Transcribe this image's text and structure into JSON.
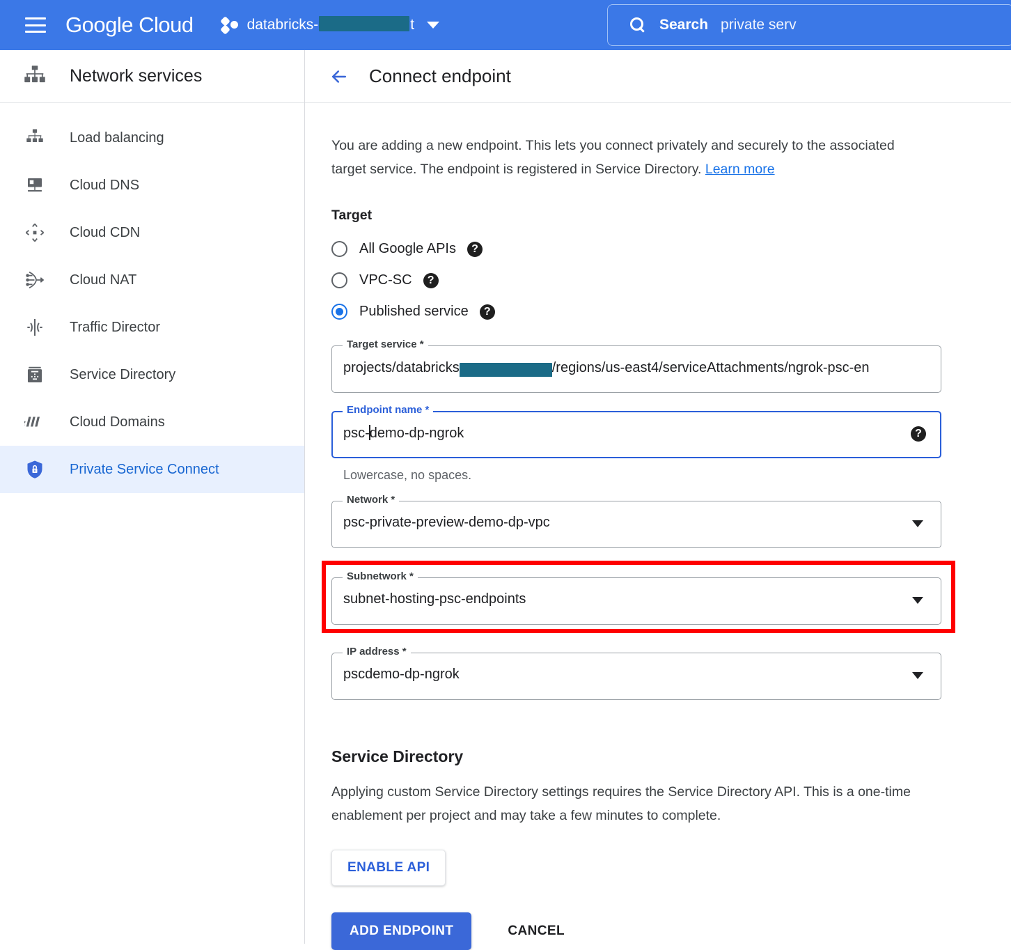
{
  "topbar": {
    "menu_icon": "hamburger-menu-icon",
    "logo_google": "Google",
    "logo_cloud": " Cloud",
    "project_icon": "project-hexagons-icon",
    "project_prefix": "databricks-",
    "project_suffix": "t",
    "project_redacted": true,
    "caret_icon": "chevron-down-icon",
    "search": {
      "icon": "search-icon",
      "label": "Search",
      "value": "private serv"
    },
    "bg_color": "#3b78e7"
  },
  "sidebar": {
    "header_icon": "network-services-icon",
    "header_title": "Network services",
    "items": [
      {
        "label": "Load balancing",
        "icon": "load-balancing-icon",
        "active": false
      },
      {
        "label": "Cloud DNS",
        "icon": "cloud-dns-icon",
        "active": false
      },
      {
        "label": "Cloud CDN",
        "icon": "cloud-cdn-icon",
        "active": false
      },
      {
        "label": "Cloud NAT",
        "icon": "cloud-nat-icon",
        "active": false
      },
      {
        "label": "Traffic Director",
        "icon": "traffic-director-icon",
        "active": false
      },
      {
        "label": "Service Directory",
        "icon": "service-directory-icon",
        "active": false
      },
      {
        "label": "Cloud Domains",
        "icon": "cloud-domains-icon",
        "active": false
      },
      {
        "label": "Private Service Connect",
        "icon": "shield-lock-icon",
        "active": true
      }
    ],
    "active_color": "#1967d2",
    "active_bg": "#e8f0fe"
  },
  "main": {
    "back_icon": "back-arrow-icon",
    "title": "Connect endpoint",
    "intro_text": "You are adding a new endpoint. This lets you connect privately and securely to the associated target service. The endpoint is registered in Service Directory. ",
    "intro_link": "Learn more",
    "target_section_label": "Target",
    "radios": [
      {
        "label": "All Google APIs",
        "selected": false,
        "help": "?"
      },
      {
        "label": "VPC-SC",
        "selected": false,
        "help": "?"
      },
      {
        "label": "Published service",
        "selected": true,
        "help": "?"
      }
    ],
    "fields": {
      "target_service": {
        "label": "Target service *",
        "value_prefix": "projects/databricks",
        "value_suffix": "/regions/us-east4/serviceAttachments/ngrok-psc-en",
        "redacted": true,
        "focused": false
      },
      "endpoint_name": {
        "label": "Endpoint name  *",
        "value_before_caret": "psc-",
        "value_after_caret": "demo-dp-ngrok",
        "helper": "Lowercase, no spaces.",
        "help": "?",
        "focused": true
      },
      "network": {
        "label": "Network *",
        "value": "psc-private-preview-demo-dp-vpc",
        "caret_icon": "dropdown-caret-icon"
      },
      "subnetwork": {
        "label": "Subnetwork *",
        "value": "subnet-hosting-psc-endpoints",
        "caret_icon": "dropdown-caret-icon",
        "highlighted": true,
        "highlight_color": "#ff0000"
      },
      "ip_address": {
        "label": "IP address *",
        "value": "pscdemo-dp-ngrok",
        "caret_icon": "dropdown-caret-icon"
      }
    },
    "service_directory": {
      "title": "Service Directory",
      "text": "Applying custom Service Directory settings requires the Service Directory API. This is a one-time enablement per project and may take a few minutes to complete.",
      "enable_button": "ENABLE API"
    },
    "actions": {
      "primary": "ADD ENDPOINT",
      "secondary": "CANCEL",
      "primary_color": "#3b68d8"
    }
  }
}
